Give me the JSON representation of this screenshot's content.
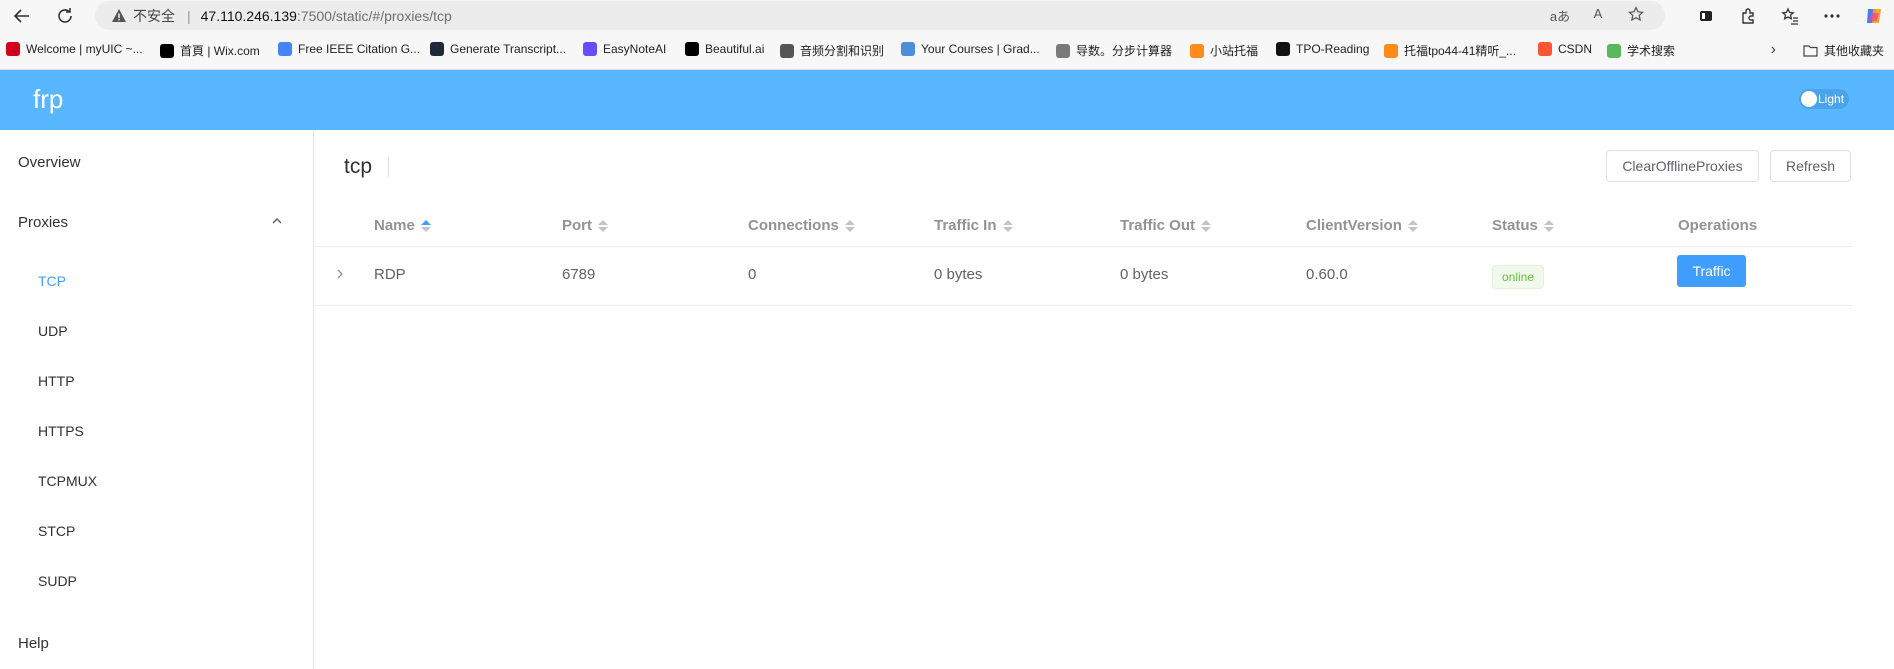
{
  "browser": {
    "security_label": "不安全",
    "url_host": "47.110.246.139",
    "url_path": ":7500/static/#/proxies/tcp",
    "read_aloud_icon": "A",
    "translate_icon": "aあ"
  },
  "bookmarks": [
    {
      "label": "Welcome | myUIC ~...",
      "icon": "uic",
      "color": "#d0021b"
    },
    {
      "label": "首頁 | Wix.com",
      "icon": "wix",
      "color": "#000000"
    },
    {
      "label": "Free IEEE Citation G...",
      "icon": "bookmark",
      "color": "#4285f4"
    },
    {
      "label": "Generate Transcript...",
      "icon": "f",
      "color": "#1e2a3a"
    },
    {
      "label": "EasyNoteAI",
      "icon": "easynote",
      "color": "#6a4cff"
    },
    {
      "label": "Beautiful.ai",
      "icon": "b.",
      "color": "#000000"
    },
    {
      "label": "音频分割和识别",
      "icon": "folder",
      "color": "#555555"
    },
    {
      "label": "Your Courses | Grad...",
      "icon": "bars",
      "color": "#4a90d9"
    },
    {
      "label": "导数。分步计算器",
      "icon": "sym",
      "color": "#7a7a7a"
    },
    {
      "label": "小站托福",
      "icon": "xz",
      "color": "#ff8c1a"
    },
    {
      "label": "TPO-Reading",
      "icon": "tpo",
      "color": "#111111"
    },
    {
      "label": "托福tpo44-41精听_...",
      "icon": "tf",
      "color": "#ff8c1a"
    },
    {
      "label": "CSDN",
      "icon": "C",
      "color": "#fc5531"
    },
    {
      "label": "学术搜索",
      "icon": "Q",
      "color": "#5cb85c"
    }
  ],
  "bookmarks_more": "其他收藏夹",
  "app": {
    "logo": "frp",
    "theme_label": "Light"
  },
  "sidebar": {
    "overview": "Overview",
    "proxies": "Proxies",
    "proxy_types": [
      "TCP",
      "UDP",
      "HTTP",
      "HTTPS",
      "TCPMUX",
      "STCP",
      "SUDP"
    ],
    "active_type": "TCP",
    "help": "Help"
  },
  "main": {
    "title": "tcp",
    "clear_button": "ClearOfflineProxies",
    "refresh_button": "Refresh",
    "columns": [
      "Name",
      "Port",
      "Connections",
      "Traffic In",
      "Traffic Out",
      "ClientVersion",
      "Status",
      "Operations"
    ],
    "rows": [
      {
        "name": "RDP",
        "port": "6789",
        "connections": "0",
        "traffic_in": "0 bytes",
        "traffic_out": "0 bytes",
        "client_version": "0.60.0",
        "status": "online",
        "operation": "Traffic"
      }
    ]
  }
}
